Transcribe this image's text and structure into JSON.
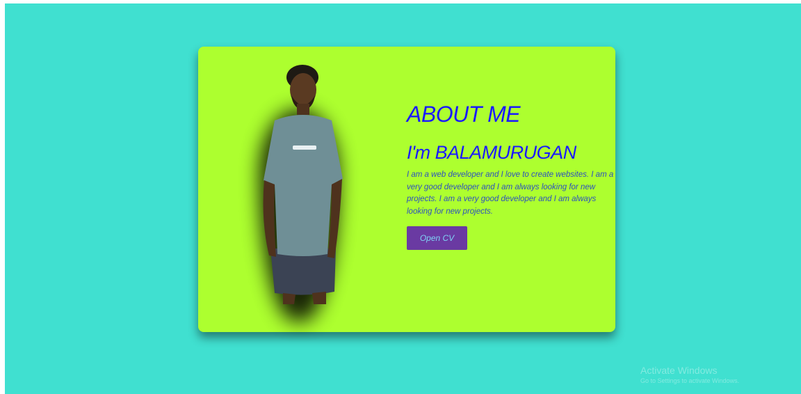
{
  "about": {
    "heading": "ABOUT ME",
    "name": "I'm BALAMURUGAN",
    "description": "I am a web developer and I love to create websites. I am a very good developer and I am always looking for new projects. I am a very good developer and I am always looking for new projects.",
    "button_label": "Open CV"
  },
  "watermark": {
    "title": "Activate Windows",
    "subtitle": "Go to Settings to activate Windows."
  },
  "colors": {
    "page_background": "#40E0D0",
    "card_background": "#ADFF2F",
    "heading": "#1A1AFF",
    "button_background": "#6A3AA2",
    "button_text": "#7FD3F5"
  },
  "icons": {
    "photo": "profile-photo"
  }
}
